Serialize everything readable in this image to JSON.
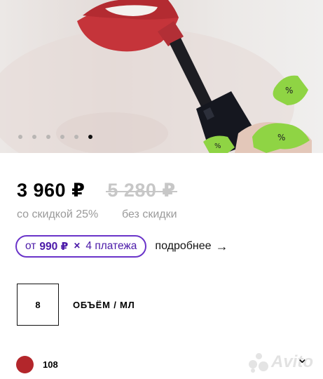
{
  "hero": {
    "image_alt": "Liquid lipstick applied to red lips",
    "gallery_count": 6,
    "active_index": 5,
    "colors": {
      "lip": "#c5343a",
      "tube": "#15171f",
      "badge": "#8fd444"
    }
  },
  "price": {
    "current": "3 960 ₽",
    "old": "5 280 ₽",
    "discount_note": "со скидкой 25%",
    "no_discount_note": "без скидки"
  },
  "installments": {
    "from": "от",
    "amount": "990 ₽",
    "times": "×",
    "count": "4 платежа",
    "more_label": "подробнее",
    "accent": "#6a34c9"
  },
  "volume": {
    "value": "8",
    "label": "ОБЪЁМ / МЛ"
  },
  "shade": {
    "value": "108",
    "color": "#b3262b"
  },
  "watermark": {
    "text": "Avito"
  },
  "icons": {
    "more": "arrow-right-icon",
    "expand": "chevron-down-icon"
  }
}
